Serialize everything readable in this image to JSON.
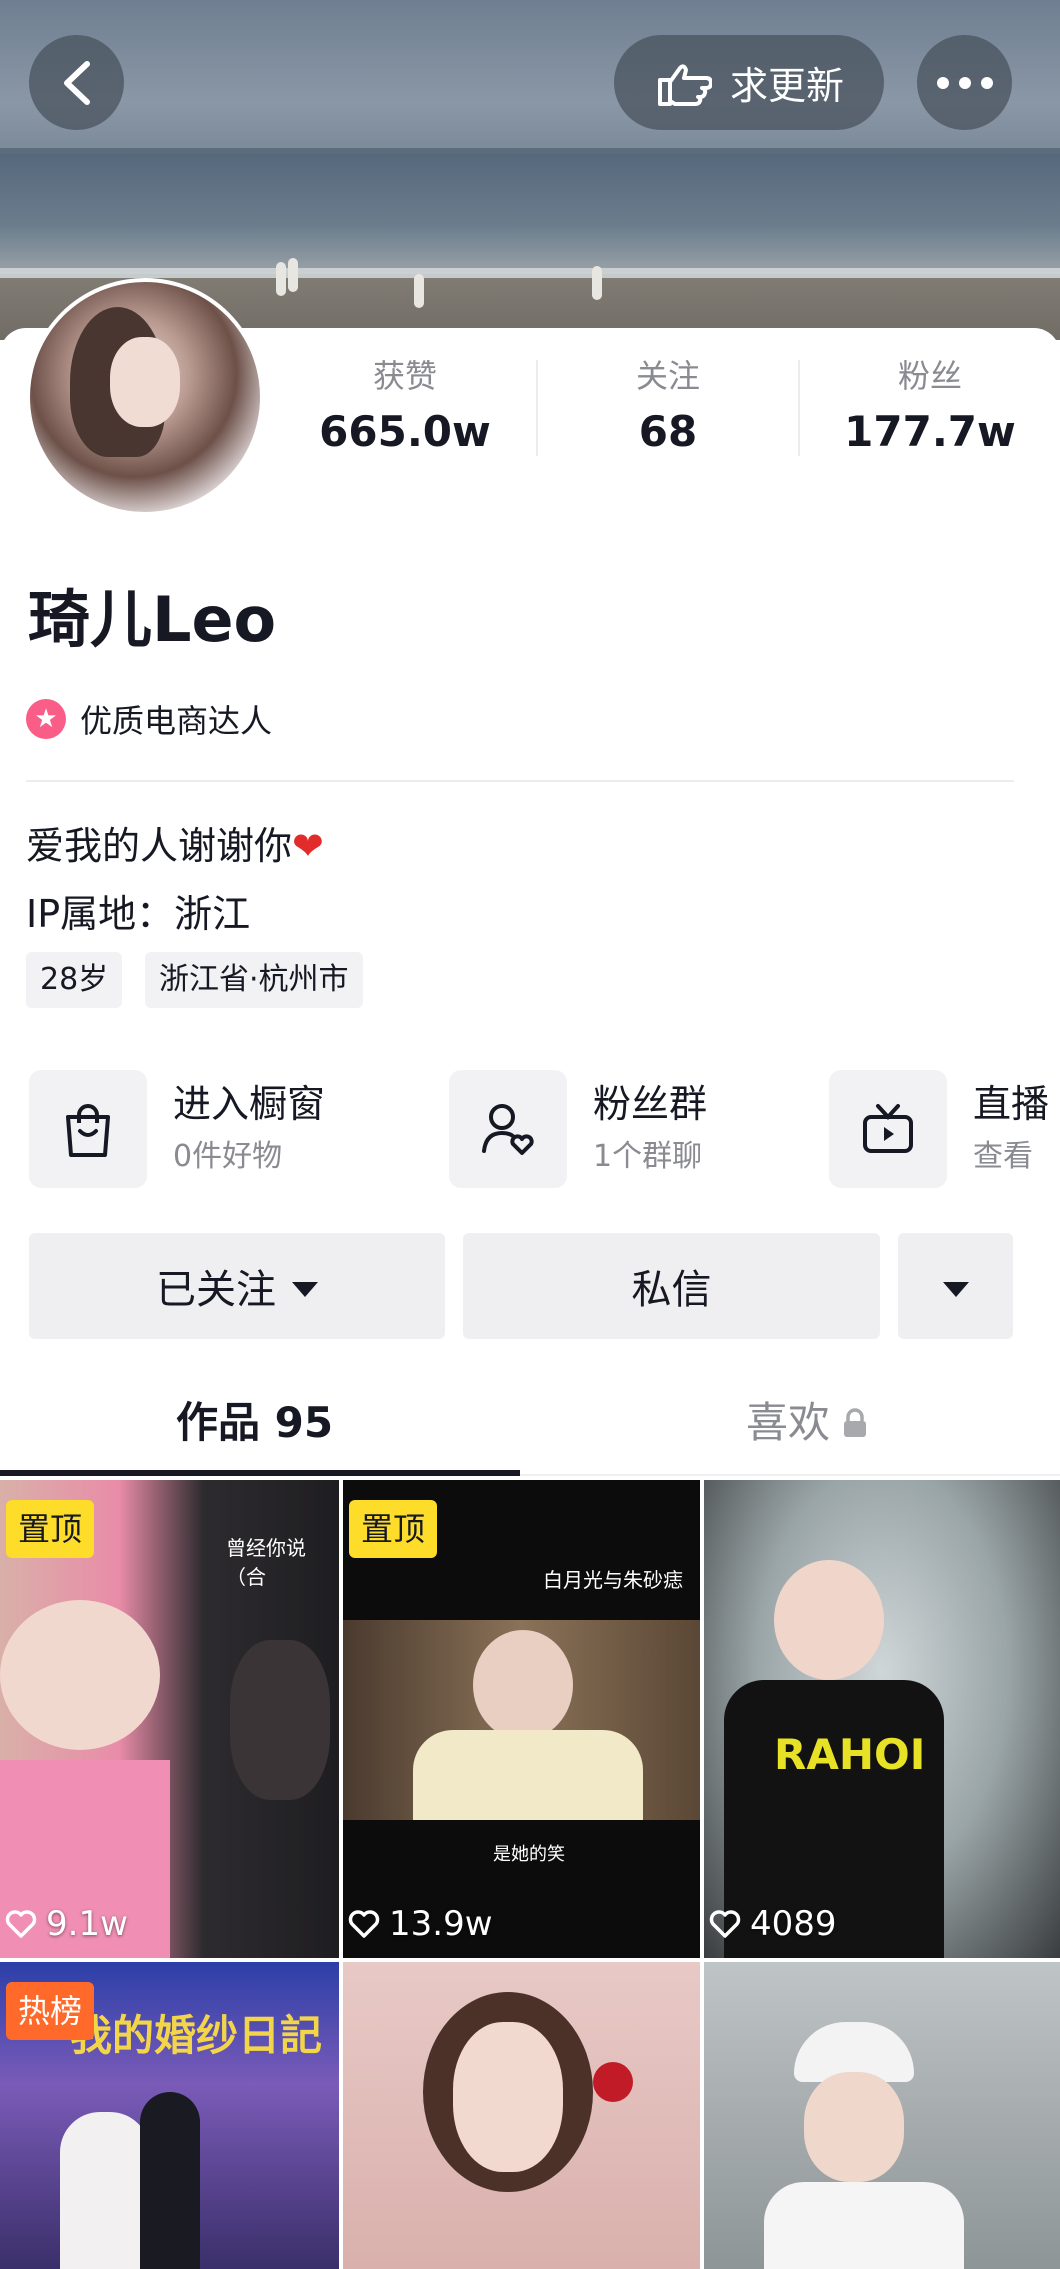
{
  "header": {
    "back_icon": "chevron-left-icon",
    "request_update_icon": "pointing-hand-icon",
    "request_update_label": "求更新",
    "more_icon": "ellipsis-icon"
  },
  "profile": {
    "stats": [
      {
        "label": "获赞",
        "value": "665.0w"
      },
      {
        "label": "关注",
        "value": "68"
      },
      {
        "label": "粉丝",
        "value": "177.7w"
      }
    ],
    "name": "琦儿Leo",
    "badge": "优质电商达人",
    "bio": "爱我的人谢谢你",
    "ip": "IP属地：浙江",
    "tags": [
      "28岁",
      "浙江省·杭州市"
    ]
  },
  "entries": [
    {
      "icon": "shopping-bag-icon",
      "title": "进入橱窗",
      "subtitle": "0件好物"
    },
    {
      "icon": "fan-group-icon",
      "title": "粉丝群",
      "subtitle": "1个群聊"
    },
    {
      "icon": "tv-icon",
      "title": "直播",
      "subtitle": "查看"
    }
  ],
  "actions": {
    "followed": "已关注",
    "message": "私信"
  },
  "tabs": [
    {
      "label": "作品 95"
    },
    {
      "label": "喜欢"
    }
  ],
  "grid": [
    {
      "badge": "置顶",
      "badge_type": "pin",
      "likes": "9.1w",
      "caption": "曾经你说（合"
    },
    {
      "badge": "置顶",
      "badge_type": "pin",
      "likes": "13.9w",
      "caption": "白月光与朱砂痣",
      "subcaption": "是她的笑"
    },
    {
      "badge": "",
      "likes": "4089",
      "caption": "RAHOI"
    },
    {
      "badge": "热榜",
      "badge_type": "hot",
      "likes": "",
      "caption": "我的婚纱日記"
    },
    {
      "badge": "",
      "likes": "",
      "caption": ""
    },
    {
      "badge": "",
      "likes": "",
      "caption": ""
    }
  ],
  "colors": {
    "pin_badge": "#fddc2a",
    "hot_badge": "#ff6a2a",
    "badge_dot": "#fa5d87",
    "heart": "#e22b2b"
  }
}
